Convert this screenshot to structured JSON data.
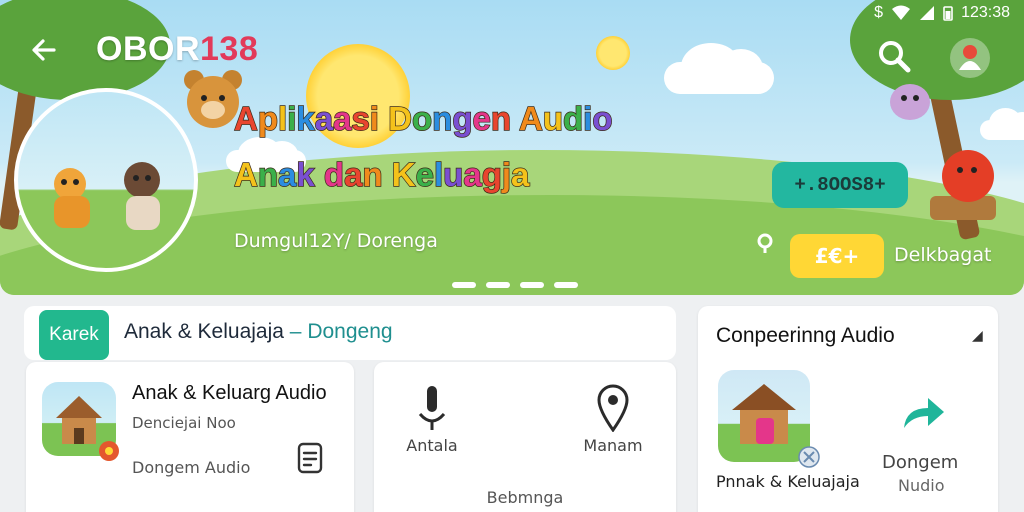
{
  "status_bar": {
    "time": "123:38"
  },
  "header": {
    "brand_part1": "OBOR",
    "brand_part2": "138"
  },
  "hero": {
    "title_line1": "Aplikaasi Dongen Audio",
    "title_line2": "Anak dan Keluagja",
    "subtitle": "Dumgul12Y/ Dorenga",
    "count_pill": "+.8OOS8+",
    "cta_button": "£€+",
    "cta_label": "Delkbagat",
    "title_colors": [
      "#e8452f",
      "#f08a1c",
      "#f4c21b",
      "#3bb04a",
      "#2b8de0",
      "#7a4fd1",
      "#e4368a"
    ]
  },
  "category": {
    "chip": "Karek",
    "text": "Anak & Keluajaja",
    "dash": "–",
    "link": "Dongeng"
  },
  "card_app": {
    "title": "Anak & Keluarg Audio",
    "subtitle": "Denciejai Noo",
    "tag": "Dongem Audio"
  },
  "card_tools": {
    "item1": "Antala",
    "item2": "Manam",
    "footer": "Bebmnga"
  },
  "card_audio": {
    "title": "Conpeerinng Audio",
    "app_label": "Pnnak & Keluajaja",
    "share_line1": "Dongem",
    "share_line2": "Nudio"
  },
  "colors": {
    "accent_green": "#22b88e",
    "teal": "#23b7a0",
    "yellow": "#ffd735",
    "brand_red": "#e23a5a",
    "sky": "#a9dcf3",
    "grass": "#8cc75a"
  }
}
